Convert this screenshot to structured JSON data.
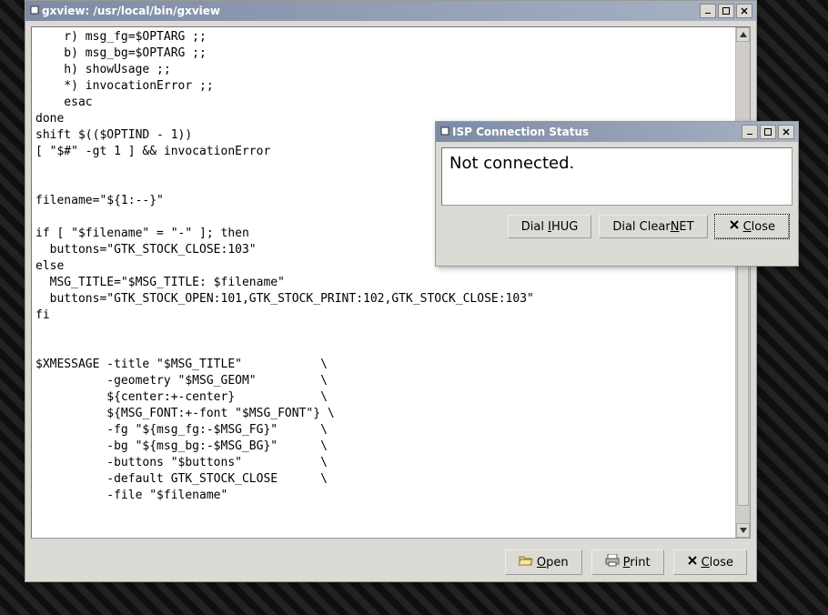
{
  "main": {
    "title": "gxview: /usr/local/bin/gxview",
    "code_lines": [
      "    r) msg_fg=$OPTARG ;;",
      "    b) msg_bg=$OPTARG ;;",
      "    h) showUsage ;;",
      "    *) invocationError ;;",
      "    esac",
      "done",
      "shift $(($OPTIND - 1))",
      "[ \"$#\" -gt 1 ] && invocationError",
      "",
      "",
      "filename=\"${1:--}\"",
      "",
      "if [ \"$filename\" = \"-\" ]; then",
      "  buttons=\"GTK_STOCK_CLOSE:103\"",
      "else",
      "  MSG_TITLE=\"$MSG_TITLE: $filename\"",
      "  buttons=\"GTK_STOCK_OPEN:101,GTK_STOCK_PRINT:102,GTK_STOCK_CLOSE:103\"",
      "fi",
      "",
      "",
      "$XMESSAGE -title \"$MSG_TITLE\"           \\",
      "          -geometry \"$MSG_GEOM\"         \\",
      "          ${center:+-center}            \\",
      "          ${MSG_FONT:+-font \"$MSG_FONT\"} \\",
      "          -fg \"${msg_fg:-$MSG_FG}\"      \\",
      "          -bg \"${msg_bg:-$MSG_BG}\"      \\",
      "          -buttons \"$buttons\"           \\",
      "          -default GTK_STOCK_CLOSE      \\",
      "          -file \"$filename\"",
      ""
    ],
    "buttons": {
      "open": "Open",
      "print": "Print",
      "close": "Close"
    }
  },
  "dialog": {
    "title": "ISP Connection Status",
    "message": "Not connected.",
    "buttons": {
      "dial_ihug_pre": "Dial ",
      "dial_ihug_u": "I",
      "dial_ihug_post": "HUG",
      "dial_clearnet_pre": "Dial Clear",
      "dial_clearnet_u": "N",
      "dial_clearnet_post": "ET",
      "close": "Close"
    }
  }
}
